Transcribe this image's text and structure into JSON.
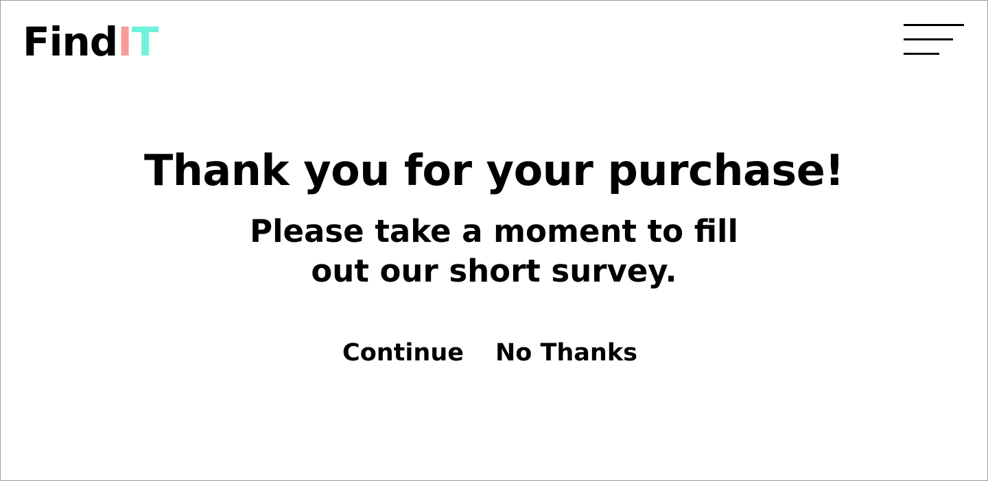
{
  "brand": {
    "name_part1": "Find",
    "name_part2": "I",
    "name_part3": "T",
    "colors": {
      "text": "#000000",
      "i_accent": "#f59b99",
      "t_accent": "#6ff2dc"
    }
  },
  "header": {
    "menu_icon": "hamburger-menu-icon"
  },
  "main": {
    "title": "Thank you for your purchase!",
    "subtitle_line1": "Please take a moment to fill",
    "subtitle_line2": "out our short survey.",
    "continue_label": "Continue",
    "no_thanks_label": "No Thanks"
  }
}
